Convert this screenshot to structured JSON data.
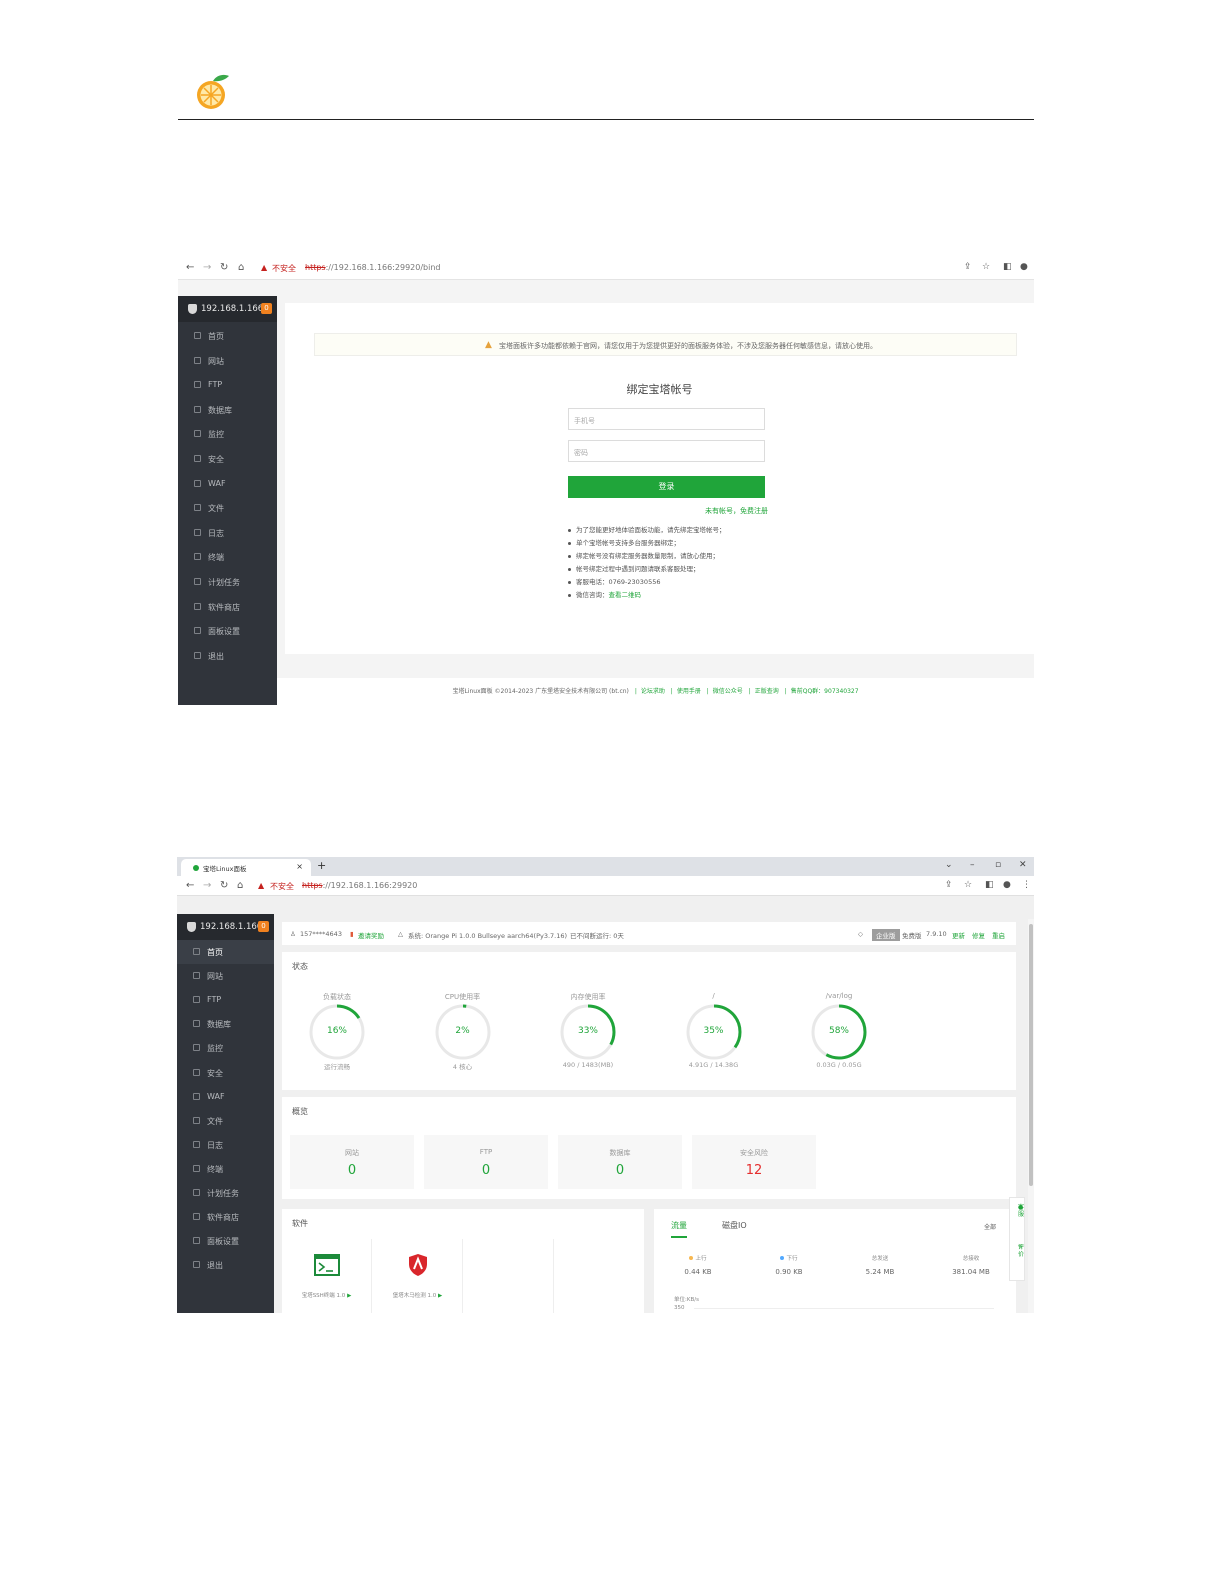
{
  "shot1": {
    "browser": {
      "insecure_label": "不安全",
      "url_scheme": "https",
      "url_rest": "://192.168.1.166:29920/bind"
    },
    "sidebar": {
      "server_ip": "192.168.1.166",
      "badge": "0",
      "items": [
        {
          "label": "首页"
        },
        {
          "label": "网站"
        },
        {
          "label": "FTP"
        },
        {
          "label": "数据库"
        },
        {
          "label": "监控"
        },
        {
          "label": "安全"
        },
        {
          "label": "WAF"
        },
        {
          "label": "文件"
        },
        {
          "label": "日志"
        },
        {
          "label": "终端"
        },
        {
          "label": "计划任务"
        },
        {
          "label": "软件商店"
        },
        {
          "label": "面板设置"
        },
        {
          "label": "退出"
        }
      ]
    },
    "warning": "宝塔面板许多功能都依赖于官网，请您仅用于为您提供更好的面板服务体验，不涉及您服务器任何敏感信息，请放心使用。",
    "bind_title": "绑定宝塔帐号",
    "phone_placeholder": "手机号",
    "password_placeholder": "密码",
    "login_button": "登录",
    "register_link": "未有帐号，免费注册",
    "notes": [
      {
        "text": "为了您能更好地体验面板功能，请先绑定宝塔帐号；"
      },
      {
        "text": "单个宝塔帐号支持多台服务器绑定；"
      },
      {
        "text": "绑定帐号没有绑定服务器数量限制，请放心使用；"
      },
      {
        "text": "帐号绑定过程中遇到问题请联系客服处理；"
      },
      {
        "text": "客服电话：0769-23030556"
      },
      {
        "text": "微信咨询：",
        "link": "查看二维码"
      }
    ],
    "footer": {
      "copyright": "宝塔Linux面板 ©2014-2023 广东堡塔安全技术有限公司 (bt.cn)",
      "links": [
        "论坛求助",
        "使用手册",
        "微信公众号",
        "正版查询",
        "售前QQ群：907340327"
      ]
    }
  },
  "shot2": {
    "tab_title": "宝塔Linux面板",
    "browser": {
      "insecure_label": "不安全",
      "url_scheme": "https",
      "url_rest": "://192.168.1.166:29920"
    },
    "sidebar": {
      "server_ip": "192.168.1.166",
      "badge": "0",
      "items": [
        {
          "label": "首页"
        },
        {
          "label": "网站"
        },
        {
          "label": "FTP"
        },
        {
          "label": "数据库"
        },
        {
          "label": "监控"
        },
        {
          "label": "安全"
        },
        {
          "label": "WAF"
        },
        {
          "label": "文件"
        },
        {
          "label": "日志"
        },
        {
          "label": "终端"
        },
        {
          "label": "计划任务"
        },
        {
          "label": "软件商店"
        },
        {
          "label": "面板设置"
        },
        {
          "label": "退出"
        }
      ]
    },
    "topinfo": {
      "user": "157****4643",
      "reward": "邀请奖励",
      "system": "系统: Orange Pi 1.0.0 Bullseye aarch64(Py3.7.16)",
      "uptime": "已不间断运行: 0天",
      "edition_pill": "企业版",
      "edition": "免费版",
      "version": "7.9.10",
      "update": "更新",
      "repair": "修复",
      "restart": "重启"
    },
    "status": {
      "title": "状态",
      "gauges": [
        {
          "label": "负载状态",
          "value": "16%",
          "pct": 16,
          "sub": "运行流畅"
        },
        {
          "label": "CPU使用率",
          "value": "2%",
          "pct": 2,
          "sub": "4 核心"
        },
        {
          "label": "内存使用率",
          "value": "33%",
          "pct": 33,
          "sub": "490 / 1483(MB)"
        },
        {
          "label": "/",
          "value": "35%",
          "pct": 35,
          "sub": "4.91G / 14.38G"
        },
        {
          "label": "/var/log",
          "value": "58%",
          "pct": 58,
          "sub": "0.03G / 0.05G"
        }
      ]
    },
    "overview": {
      "title": "概览",
      "boxes": [
        {
          "label": "网站",
          "value": "0"
        },
        {
          "label": "FTP",
          "value": "0"
        },
        {
          "label": "数据库",
          "value": "0"
        },
        {
          "label": "安全风险",
          "value": "12"
        }
      ]
    },
    "software": {
      "title": "软件",
      "items": [
        {
          "label": "宝塔SSH终端 1.0"
        },
        {
          "label": "堡塔木马检测 1.0"
        }
      ]
    },
    "traffic": {
      "tab_traffic": "流量",
      "tab_disk": "磁盘IO",
      "right": "全部",
      "stats": [
        {
          "label": "上行",
          "value": "0.44 KB"
        },
        {
          "label": "下行",
          "value": "0.90 KB"
        },
        {
          "label": "总发送",
          "value": "5.24 MB"
        },
        {
          "label": "总接收",
          "value": "381.04 MB"
        }
      ],
      "unit": "单位:KB/s",
      "axis_top": "350"
    },
    "float": {
      "service": "客服",
      "feedback": "评价"
    }
  }
}
